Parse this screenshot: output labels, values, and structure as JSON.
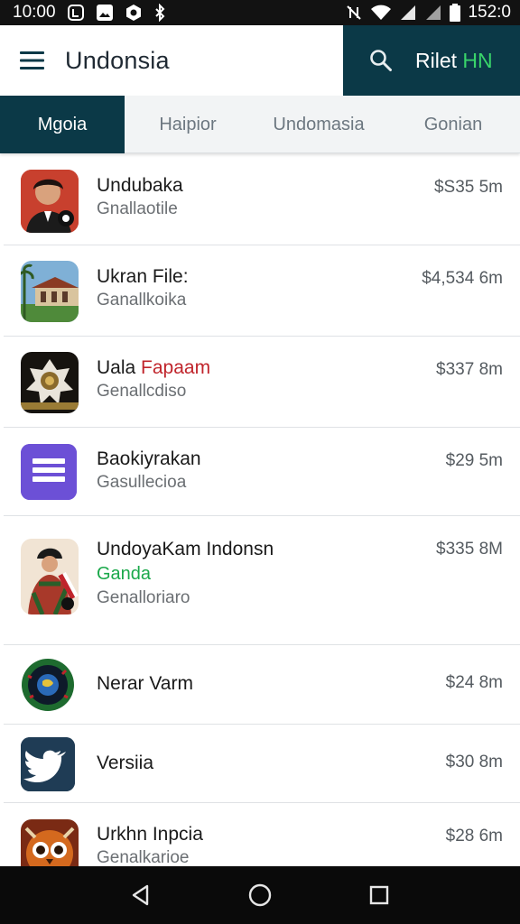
{
  "status_bar": {
    "time": "10:00",
    "left_icons": [
      "notification-icon",
      "photo-icon",
      "settings-icon",
      "bluetooth-icon"
    ],
    "right_icons": [
      "nfc-icon",
      "wifi-icon",
      "signal-icon",
      "signal-icon",
      "battery-icon"
    ],
    "right_text": "152:0"
  },
  "app_bar": {
    "title": "Undonsia",
    "account_label_main": "Rilet ",
    "account_label_accent": "HN",
    "accent_color": "#39d46a",
    "brand_color": "#0b3947"
  },
  "tabs": [
    {
      "label": "Mgoia",
      "active": true
    },
    {
      "label": "Haipior",
      "active": false
    },
    {
      "label": "Undomasia",
      "active": false
    },
    {
      "label": "Gonian",
      "active": false
    }
  ],
  "items": [
    {
      "name": "Undubaka",
      "subtitle": "Gnallaotile",
      "price": "$S35 5m",
      "icon": "portrait-icon"
    },
    {
      "name": "Ukran File:",
      "subtitle": "Ganallkoika",
      "price": "$4,534 6m",
      "icon": "building-photo-icon"
    },
    {
      "name_prefix": "Uala ",
      "name_highlight": "Fapaam",
      "subtitle": "Genallcdiso",
      "price": "$337 8m",
      "icon": "emblem-icon",
      "highlight_color": "#c0242b"
    },
    {
      "name": "Baokiyrakan",
      "subtitle": "Gasullecioa",
      "price": "$29 5m",
      "icon": "menu-lines-icon"
    },
    {
      "name": "UndoyaKam Indonsn",
      "tag": "Ganda",
      "subtitle": "Genalloriaro",
      "price": "$335 8M",
      "icon": "traditional-dancer-icon",
      "tag_color": "#1aa84a"
    },
    {
      "name": "Nerar Varm",
      "subtitle": "",
      "price": "$24 8m",
      "icon": "globe-emblem-icon"
    },
    {
      "name": "Versiia",
      "subtitle": "",
      "price": "$30 8m",
      "icon": "bird-icon"
    },
    {
      "name": "Urkhn Inpcia",
      "subtitle": "Genalkarioe",
      "price": "$28 6m",
      "icon": "owl-icon"
    }
  ],
  "nav_bar": {
    "buttons": [
      "back-icon",
      "home-icon",
      "recents-icon"
    ]
  }
}
